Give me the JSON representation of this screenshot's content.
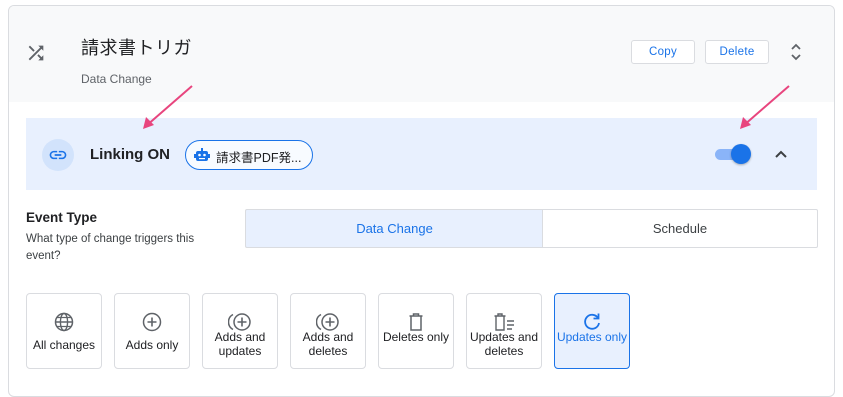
{
  "header": {
    "title": "請求書トリガ",
    "subtitle": "Data Change",
    "copy_label": "Copy",
    "delete_label": "Delete",
    "icon": "shuffle-icon"
  },
  "linking": {
    "label": "Linking ON",
    "chip_label": "請求書PDF発...",
    "chip_icon": "bot-icon",
    "toggle_on": true
  },
  "event_type": {
    "label": "Event Type",
    "help": "What type of change triggers this event?",
    "tabs": [
      {
        "label": "Data Change",
        "selected": true
      },
      {
        "label": "Schedule",
        "selected": false
      }
    ]
  },
  "change_types": [
    {
      "label": "All changes",
      "icon": "globe-icon",
      "selected": false
    },
    {
      "label": "Adds only",
      "icon": "add-circle-icon",
      "selected": false
    },
    {
      "label": "Adds and updates",
      "icon": "add-update-icon",
      "selected": false
    },
    {
      "label": "Adds and deletes",
      "icon": "add-delete-icon",
      "selected": false
    },
    {
      "label": "Deletes only",
      "icon": "trash-icon",
      "selected": false
    },
    {
      "label": "Updates and deletes",
      "icon": "trash-list-icon",
      "selected": false
    },
    {
      "label": "Updates only",
      "icon": "refresh-icon",
      "selected": true
    }
  ],
  "colors": {
    "accent": "#1a73e8",
    "accent_light": "#e8f0fe",
    "annotation_arrow": "#e8457e"
  }
}
